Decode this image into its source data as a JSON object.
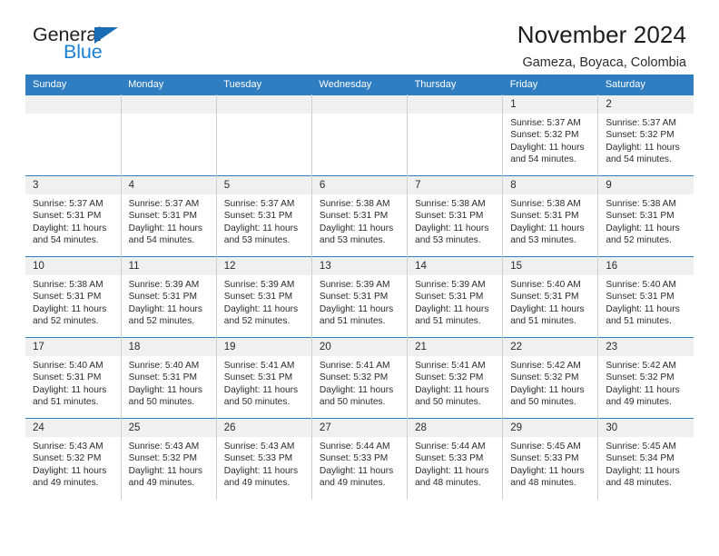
{
  "brand": {
    "word_one": "General",
    "word_two": "Blue",
    "triangle_icon": "blue-triangle-icon",
    "accent": "#1a7fd4"
  },
  "header": {
    "title": "November 2024",
    "subtitle": "Gameza, Boyaca, Colombia"
  },
  "calendar": {
    "header_bg": "#2f7ec1",
    "daynum_bg": "#f0f0f0",
    "weekday_headers": [
      "Sunday",
      "Monday",
      "Tuesday",
      "Wednesday",
      "Thursday",
      "Friday",
      "Saturday"
    ],
    "weeks": [
      [
        {
          "day": "",
          "sunrise": "",
          "sunset": "",
          "daylight_line1": "",
          "daylight_line2": "",
          "empty": true
        },
        {
          "day": "",
          "sunrise": "",
          "sunset": "",
          "daylight_line1": "",
          "daylight_line2": "",
          "empty": true
        },
        {
          "day": "",
          "sunrise": "",
          "sunset": "",
          "daylight_line1": "",
          "daylight_line2": "",
          "empty": true
        },
        {
          "day": "",
          "sunrise": "",
          "sunset": "",
          "daylight_line1": "",
          "daylight_line2": "",
          "empty": true
        },
        {
          "day": "",
          "sunrise": "",
          "sunset": "",
          "daylight_line1": "",
          "daylight_line2": "",
          "empty": true
        },
        {
          "day": "1",
          "sunrise": "Sunrise: 5:37 AM",
          "sunset": "Sunset: 5:32 PM",
          "daylight_line1": "Daylight: 11 hours",
          "daylight_line2": "and 54 minutes."
        },
        {
          "day": "2",
          "sunrise": "Sunrise: 5:37 AM",
          "sunset": "Sunset: 5:32 PM",
          "daylight_line1": "Daylight: 11 hours",
          "daylight_line2": "and 54 minutes."
        }
      ],
      [
        {
          "day": "3",
          "sunrise": "Sunrise: 5:37 AM",
          "sunset": "Sunset: 5:31 PM",
          "daylight_line1": "Daylight: 11 hours",
          "daylight_line2": "and 54 minutes."
        },
        {
          "day": "4",
          "sunrise": "Sunrise: 5:37 AM",
          "sunset": "Sunset: 5:31 PM",
          "daylight_line1": "Daylight: 11 hours",
          "daylight_line2": "and 54 minutes."
        },
        {
          "day": "5",
          "sunrise": "Sunrise: 5:37 AM",
          "sunset": "Sunset: 5:31 PM",
          "daylight_line1": "Daylight: 11 hours",
          "daylight_line2": "and 53 minutes."
        },
        {
          "day": "6",
          "sunrise": "Sunrise: 5:38 AM",
          "sunset": "Sunset: 5:31 PM",
          "daylight_line1": "Daylight: 11 hours",
          "daylight_line2": "and 53 minutes."
        },
        {
          "day": "7",
          "sunrise": "Sunrise: 5:38 AM",
          "sunset": "Sunset: 5:31 PM",
          "daylight_line1": "Daylight: 11 hours",
          "daylight_line2": "and 53 minutes."
        },
        {
          "day": "8",
          "sunrise": "Sunrise: 5:38 AM",
          "sunset": "Sunset: 5:31 PM",
          "daylight_line1": "Daylight: 11 hours",
          "daylight_line2": "and 53 minutes."
        },
        {
          "day": "9",
          "sunrise": "Sunrise: 5:38 AM",
          "sunset": "Sunset: 5:31 PM",
          "daylight_line1": "Daylight: 11 hours",
          "daylight_line2": "and 52 minutes."
        }
      ],
      [
        {
          "day": "10",
          "sunrise": "Sunrise: 5:38 AM",
          "sunset": "Sunset: 5:31 PM",
          "daylight_line1": "Daylight: 11 hours",
          "daylight_line2": "and 52 minutes."
        },
        {
          "day": "11",
          "sunrise": "Sunrise: 5:39 AM",
          "sunset": "Sunset: 5:31 PM",
          "daylight_line1": "Daylight: 11 hours",
          "daylight_line2": "and 52 minutes."
        },
        {
          "day": "12",
          "sunrise": "Sunrise: 5:39 AM",
          "sunset": "Sunset: 5:31 PM",
          "daylight_line1": "Daylight: 11 hours",
          "daylight_line2": "and 52 minutes."
        },
        {
          "day": "13",
          "sunrise": "Sunrise: 5:39 AM",
          "sunset": "Sunset: 5:31 PM",
          "daylight_line1": "Daylight: 11 hours",
          "daylight_line2": "and 51 minutes."
        },
        {
          "day": "14",
          "sunrise": "Sunrise: 5:39 AM",
          "sunset": "Sunset: 5:31 PM",
          "daylight_line1": "Daylight: 11 hours",
          "daylight_line2": "and 51 minutes."
        },
        {
          "day": "15",
          "sunrise": "Sunrise: 5:40 AM",
          "sunset": "Sunset: 5:31 PM",
          "daylight_line1": "Daylight: 11 hours",
          "daylight_line2": "and 51 minutes."
        },
        {
          "day": "16",
          "sunrise": "Sunrise: 5:40 AM",
          "sunset": "Sunset: 5:31 PM",
          "daylight_line1": "Daylight: 11 hours",
          "daylight_line2": "and 51 minutes."
        }
      ],
      [
        {
          "day": "17",
          "sunrise": "Sunrise: 5:40 AM",
          "sunset": "Sunset: 5:31 PM",
          "daylight_line1": "Daylight: 11 hours",
          "daylight_line2": "and 51 minutes."
        },
        {
          "day": "18",
          "sunrise": "Sunrise: 5:40 AM",
          "sunset": "Sunset: 5:31 PM",
          "daylight_line1": "Daylight: 11 hours",
          "daylight_line2": "and 50 minutes."
        },
        {
          "day": "19",
          "sunrise": "Sunrise: 5:41 AM",
          "sunset": "Sunset: 5:31 PM",
          "daylight_line1": "Daylight: 11 hours",
          "daylight_line2": "and 50 minutes."
        },
        {
          "day": "20",
          "sunrise": "Sunrise: 5:41 AM",
          "sunset": "Sunset: 5:32 PM",
          "daylight_line1": "Daylight: 11 hours",
          "daylight_line2": "and 50 minutes."
        },
        {
          "day": "21",
          "sunrise": "Sunrise: 5:41 AM",
          "sunset": "Sunset: 5:32 PM",
          "daylight_line1": "Daylight: 11 hours",
          "daylight_line2": "and 50 minutes."
        },
        {
          "day": "22",
          "sunrise": "Sunrise: 5:42 AM",
          "sunset": "Sunset: 5:32 PM",
          "daylight_line1": "Daylight: 11 hours",
          "daylight_line2": "and 50 minutes."
        },
        {
          "day": "23",
          "sunrise": "Sunrise: 5:42 AM",
          "sunset": "Sunset: 5:32 PM",
          "daylight_line1": "Daylight: 11 hours",
          "daylight_line2": "and 49 minutes."
        }
      ],
      [
        {
          "day": "24",
          "sunrise": "Sunrise: 5:43 AM",
          "sunset": "Sunset: 5:32 PM",
          "daylight_line1": "Daylight: 11 hours",
          "daylight_line2": "and 49 minutes."
        },
        {
          "day": "25",
          "sunrise": "Sunrise: 5:43 AM",
          "sunset": "Sunset: 5:32 PM",
          "daylight_line1": "Daylight: 11 hours",
          "daylight_line2": "and 49 minutes."
        },
        {
          "day": "26",
          "sunrise": "Sunrise: 5:43 AM",
          "sunset": "Sunset: 5:33 PM",
          "daylight_line1": "Daylight: 11 hours",
          "daylight_line2": "and 49 minutes."
        },
        {
          "day": "27",
          "sunrise": "Sunrise: 5:44 AM",
          "sunset": "Sunset: 5:33 PM",
          "daylight_line1": "Daylight: 11 hours",
          "daylight_line2": "and 49 minutes."
        },
        {
          "day": "28",
          "sunrise": "Sunrise: 5:44 AM",
          "sunset": "Sunset: 5:33 PM",
          "daylight_line1": "Daylight: 11 hours",
          "daylight_line2": "and 48 minutes."
        },
        {
          "day": "29",
          "sunrise": "Sunrise: 5:45 AM",
          "sunset": "Sunset: 5:33 PM",
          "daylight_line1": "Daylight: 11 hours",
          "daylight_line2": "and 48 minutes."
        },
        {
          "day": "30",
          "sunrise": "Sunrise: 5:45 AM",
          "sunset": "Sunset: 5:34 PM",
          "daylight_line1": "Daylight: 11 hours",
          "daylight_line2": "and 48 minutes."
        }
      ]
    ]
  }
}
